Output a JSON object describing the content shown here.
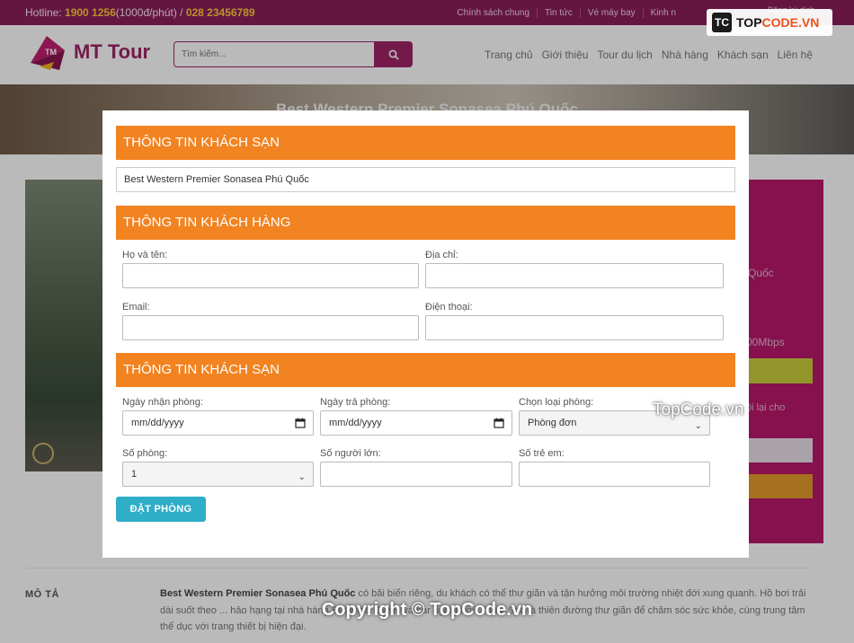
{
  "topbar": {
    "hotline_label": "Hotline: ",
    "hotline_number": "1900 1256",
    "hotline_rate": "(1000đ/phút) / ",
    "hotline_alt": "028 23456789",
    "links": [
      "Chính sách chung",
      "Tin tức",
      "Vé máy bay",
      "Kinh n"
    ],
    "login": "Đăng ký dịch"
  },
  "watermark": {
    "badge_icon": "TC",
    "badge_text_a": "TOP",
    "badge_text_b": "CODE.VN",
    "middle": "TopCode.vn",
    "bottom": "Copyright © TopCode.vn"
  },
  "header": {
    "logo_text": "MT Tour",
    "search_placeholder": "Tìm kiếm...",
    "nav": [
      "Trang chủ",
      "Giới thiệu",
      "Tour du lịch",
      "Nhà hàng",
      "Khách sạn",
      "Liên hệ"
    ]
  },
  "banner": {
    "title": "Best Western Premier Sonasea Phú Quốc"
  },
  "background": {
    "side_text_1": "Quốc",
    "side_text_2": "00Mbps",
    "side_text_3": "ội lại cho",
    "desc_label": "MÔ TẢ",
    "desc_bold": "Best Western Premier Sonasea Phú Quốc",
    "desc_text": " có bãi biển riêng, du khách có thể thư giãn và tận hưởng môi trường nhiệt đới xung quanh. Hồ bơi trải dài suốt theo ... hảo hạng tại nhà hàng Essence. Oasis và bar ngoài trời. Thala Spa là thiên đường thư giãn để chăm sóc sức khỏe, cùng trung tâm thể dục với trang thiết bị hiện đại."
  },
  "modal": {
    "section_hotel": "THÔNG TIN KHÁCH SẠN",
    "hotel_value": "Best Western Premier Sonasea Phú Quốc",
    "section_customer": "THÔNG TIN KHÁCH HÀNG",
    "name_label": "Họ và tên:",
    "address_label": "Địa chỉ:",
    "email_label": "Email:",
    "phone_label": "Điện thoại:",
    "section_booking": "THÔNG TIN KHÁCH SẠN",
    "checkin_label": "Ngày nhận phòng:",
    "checkin_value": "mm/dd/yyyy",
    "checkout_label": "Ngày trả phòng:",
    "checkout_value": "mm/dd/yyyy",
    "roomtype_label": "Chọn loại phòng:",
    "roomtype_value": "Phòng đơn",
    "rooms_label": "Số phòng:",
    "rooms_value": "1",
    "adults_label": "Số người lớn:",
    "children_label": "Số trẻ em:",
    "submit": "ĐẶT PHÒNG"
  },
  "colors": {
    "brand": "#a02466",
    "section_orange": "#f28321",
    "button_teal": "#2eaec7"
  }
}
